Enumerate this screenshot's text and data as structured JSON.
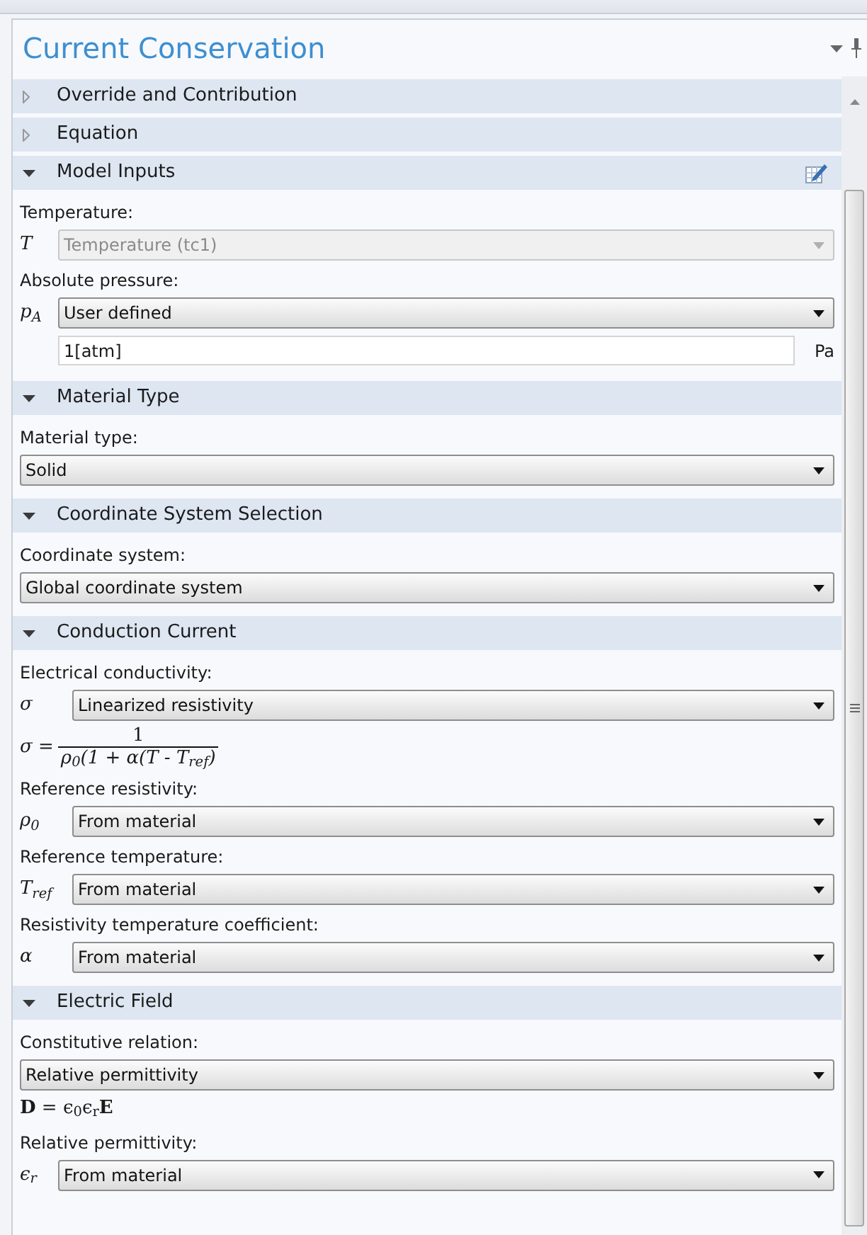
{
  "panel": {
    "title": "Current Conservation"
  },
  "sections": [
    {
      "title": "Override and Contribution",
      "expanded": false
    },
    {
      "title": "Equation",
      "expanded": false
    },
    {
      "title": "Model Inputs",
      "expanded": true,
      "edit_icon": true,
      "items": [
        {
          "kind": "label",
          "text": "Temperature:"
        },
        {
          "kind": "select",
          "symbol": "T",
          "value": "Temperature (tc1)",
          "disabled": true
        },
        {
          "kind": "label",
          "text": "Absolute pressure:"
        },
        {
          "kind": "select",
          "symbol": "p$_{A}$",
          "value": "User defined",
          "disabled": false
        },
        {
          "kind": "input",
          "value": "1[atm]",
          "unit": "Pa"
        }
      ]
    },
    {
      "title": "Material Type",
      "expanded": true,
      "items": [
        {
          "kind": "label",
          "text": "Material type:"
        },
        {
          "kind": "select",
          "value": "Solid",
          "disabled": false
        }
      ]
    },
    {
      "title": "Coordinate System Selection",
      "expanded": true,
      "items": [
        {
          "kind": "label",
          "text": "Coordinate system:"
        },
        {
          "kind": "select",
          "value": "Global coordinate system",
          "disabled": false
        }
      ]
    },
    {
      "title": "Conduction Current",
      "expanded": true,
      "items": [
        {
          "kind": "label",
          "text": "Electrical conductivity:"
        },
        {
          "kind": "select",
          "symbol": "σ",
          "value": "Linearized resistivity",
          "disabled": false
        },
        {
          "kind": "fraction",
          "lhs": "σ =",
          "numerator": "1",
          "denominator": "ρ$_{0}$(1 + α(T - T$_{ref}$)"
        },
        {
          "kind": "label",
          "text": "Reference resistivity:"
        },
        {
          "kind": "select",
          "symbol": "ρ$_{0}$",
          "value": "From material",
          "disabled": false
        },
        {
          "kind": "label",
          "text": "Reference temperature:"
        },
        {
          "kind": "select",
          "symbol": "T$_{ref}$",
          "value": "From material",
          "disabled": false
        },
        {
          "kind": "label",
          "text": "Resistivity temperature coefficient:"
        },
        {
          "kind": "select",
          "symbol": "α",
          "value": "From material",
          "disabled": false
        }
      ]
    },
    {
      "title": "Electric Field",
      "expanded": true,
      "items": [
        {
          "kind": "label",
          "text": "Constitutive relation:"
        },
        {
          "kind": "select",
          "value": "Relative permittivity",
          "disabled": false
        },
        {
          "kind": "equation",
          "text": "**D** = ϵ$_{0}$ϵ$_{r}$**E**"
        },
        {
          "kind": "label",
          "text": "Relative permittivity:"
        },
        {
          "kind": "select",
          "symbol": "ϵ$_{r}$",
          "value": "From material",
          "disabled": false
        }
      ]
    }
  ]
}
